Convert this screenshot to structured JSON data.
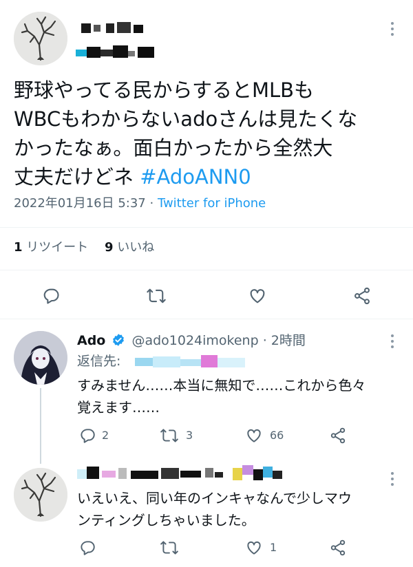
{
  "main_tweet": {
    "text_lines": [
      "野球やってる民からするとMLBも",
      "WBCもわからないadoさんは見たくな",
      "かったなぁ。面白かったから全然大",
      "丈夫だけどネ"
    ],
    "hashtag": "#AdoANN0",
    "date": "2022年01月16日 5:37",
    "separator": " · ",
    "source": "Twitter for iPhone",
    "retweets_count": "1",
    "retweets_label": "リツイート",
    "likes_count": "9",
    "likes_label": "いいね"
  },
  "reply_1": {
    "name": "Ado",
    "handle": "@ado1024imokenp",
    "time": "· 2時間",
    "reply_to_label": "返信先:",
    "text_lines": [
      "すみません……本当に無知で……これから色々",
      "覚えます……"
    ],
    "reply_count": "2",
    "retweet_count": "3",
    "like_count": "66"
  },
  "reply_2": {
    "text_lines": [
      "いえいえ、同い年のインキャなんで少しマウ",
      "ンティングしちゃいました。"
    ],
    "like_count": "1"
  },
  "colors": {
    "accent": "#1d9bf0",
    "verified": "#1d9bf0",
    "muted": "#536471"
  }
}
